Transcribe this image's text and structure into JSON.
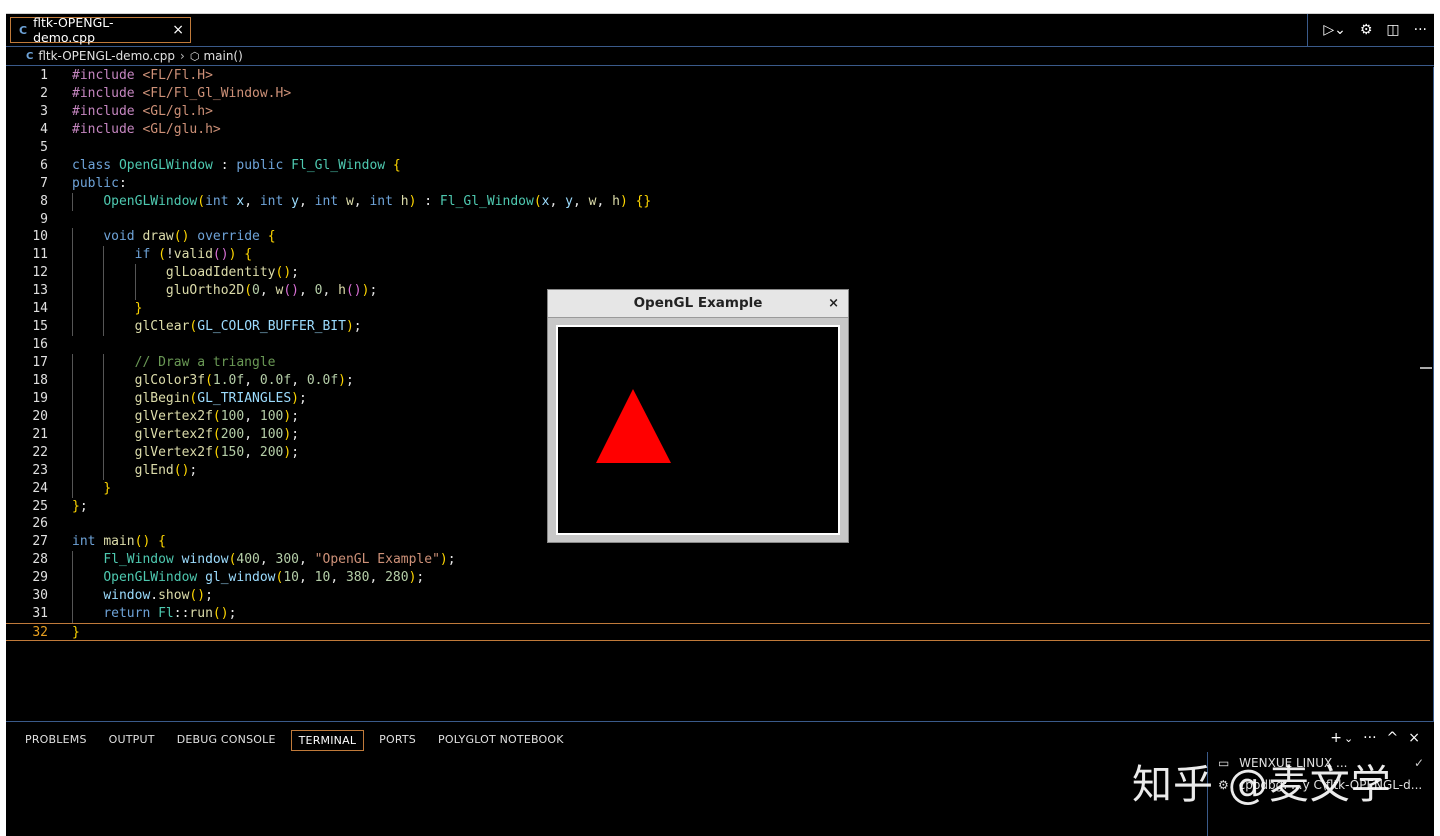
{
  "tab": {
    "label": "fltk-OPENGL-demo.cpp",
    "close": "×",
    "file_icon": "C"
  },
  "actions": {
    "run": "▷⌄",
    "settings": "⚙",
    "split": "◫",
    "more": "···"
  },
  "breadcrumb": {
    "file": "fltk-OPENGL-demo.cpp",
    "separator": "›",
    "symbol": "main()"
  },
  "panel": {
    "tabs": [
      "PROBLEMS",
      "OUTPUT",
      "DEBUG CONSOLE",
      "TERMINAL",
      "PORTS",
      "POLYGLOT NOTEBOOK"
    ],
    "active_tab": "TERMINAL",
    "actions": {
      "add": "+",
      "dropdown": "⌄",
      "more": "···",
      "maximize": "^",
      "close": "×"
    },
    "terminals": [
      {
        "icon": "▭",
        "label": "WENXUE LINUX ...",
        "check": "✓"
      },
      {
        "icon": "⚙",
        "label": "cppdbg: ...y C\\fltk-OPENGL-d..."
      }
    ]
  },
  "dialog": {
    "title": "OpenGL Example",
    "close": "×",
    "triangle_color": "#ff0000",
    "background": "#000000"
  },
  "watermark": "知乎 @麦文学",
  "editor": {
    "active_line": 32,
    "lines": [
      {
        "n": "1",
        "t": "#include <FL/Fl.H>"
      },
      {
        "n": "2",
        "t": "#include <FL/Fl_Gl_Window.H>"
      },
      {
        "n": "3",
        "t": "#include <GL/gl.h>"
      },
      {
        "n": "4",
        "t": "#include <GL/glu.h>"
      },
      {
        "n": "5",
        "t": ""
      },
      {
        "n": "6",
        "t": "class OpenGLWindow : public Fl_Gl_Window {"
      },
      {
        "n": "7",
        "t": "public:"
      },
      {
        "n": "8",
        "t": "    OpenGLWindow(int x, int y, int w, int h) : Fl_Gl_Window(x, y, w, h) {}"
      },
      {
        "n": "9",
        "t": ""
      },
      {
        "n": "10",
        "t": "    void draw() override {"
      },
      {
        "n": "11",
        "t": "        if (!valid()) {"
      },
      {
        "n": "12",
        "t": "            glLoadIdentity();"
      },
      {
        "n": "13",
        "t": "            gluOrtho2D(0, w(), 0, h());"
      },
      {
        "n": "14",
        "t": "        }"
      },
      {
        "n": "15",
        "t": "        glClear(GL_COLOR_BUFFER_BIT);"
      },
      {
        "n": "16",
        "t": ""
      },
      {
        "n": "17",
        "t": "        // Draw a triangle"
      },
      {
        "n": "18",
        "t": "        glColor3f(1.0f, 0.0f, 0.0f);"
      },
      {
        "n": "19",
        "t": "        glBegin(GL_TRIANGLES);"
      },
      {
        "n": "20",
        "t": "        glVertex2f(100, 100);"
      },
      {
        "n": "21",
        "t": "        glVertex2f(200, 100);"
      },
      {
        "n": "22",
        "t": "        glVertex2f(150, 200);"
      },
      {
        "n": "23",
        "t": "        glEnd();"
      },
      {
        "n": "24",
        "t": "    }"
      },
      {
        "n": "25",
        "t": "};"
      },
      {
        "n": "26",
        "t": ""
      },
      {
        "n": "27",
        "t": "int main() {"
      },
      {
        "n": "28",
        "t": "    Fl_Window window(400, 300, \"OpenGL Example\");"
      },
      {
        "n": "29",
        "t": "    OpenGLWindow gl_window(10, 10, 380, 280);"
      },
      {
        "n": "30",
        "t": "    window.show();"
      },
      {
        "n": "31",
        "t": "    return Fl::run();"
      },
      {
        "n": "32",
        "t": "}"
      }
    ]
  }
}
